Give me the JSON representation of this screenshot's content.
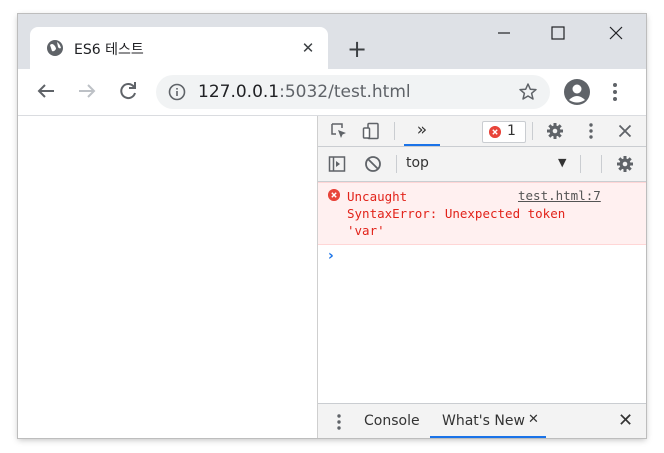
{
  "tab": {
    "title": "ES6 테스트",
    "close_glyph": "✕"
  },
  "toolbar": {
    "new_tab_glyph": "+",
    "url_host": "127.0.0.1",
    "url_rest": ":5032/test.html"
  },
  "devtools": {
    "more_tabs_glyph": "»",
    "error_count": "1",
    "context": "top",
    "context_arrow": "▼",
    "error": {
      "message": "Uncaught\nSyntaxError: Unexpected token\n'var'",
      "source": "test.html:7"
    },
    "prompt": "›",
    "drawer": {
      "tabs": [
        "Console",
        "What's New"
      ],
      "tab_close_glyph": "✕",
      "close_glyph": "✕"
    }
  },
  "colors": {
    "accent": "#1a73e8",
    "error": "#e2231a",
    "error_bg": "#fff0f0"
  }
}
